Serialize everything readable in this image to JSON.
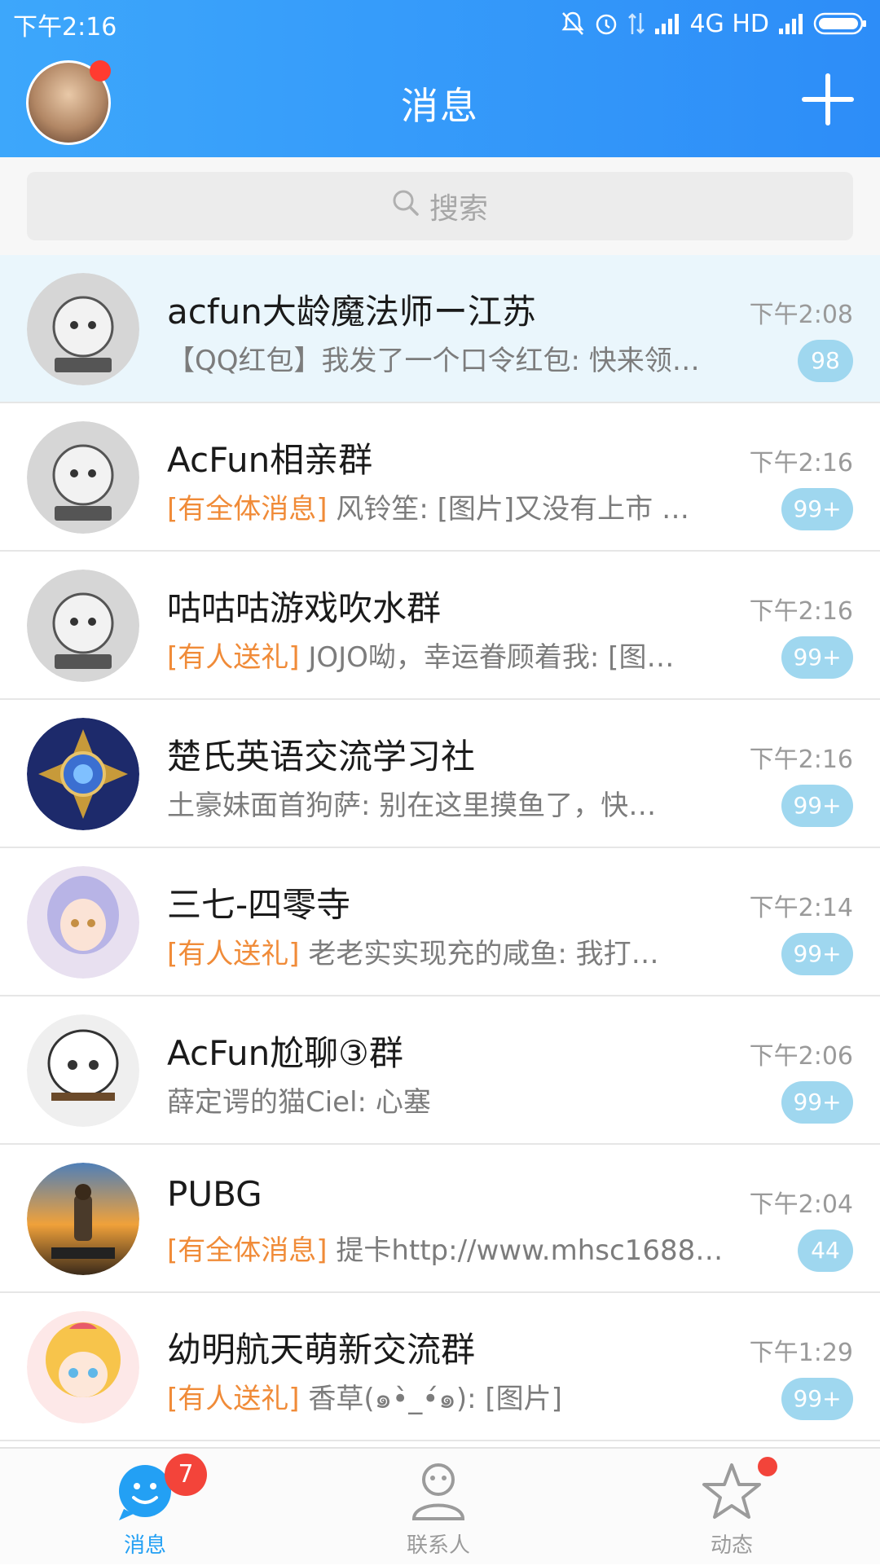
{
  "status_bar": {
    "time": "下午2:16",
    "network": "4G HD"
  },
  "header": {
    "title": "消息"
  },
  "search": {
    "placeholder": "搜索"
  },
  "conversations": [
    {
      "name": "acfun大龄魔法师ー江苏",
      "tag": "",
      "preview": "【QQ红包】我发了一个口令红包: 快来领…",
      "time": "下午2:08",
      "badge": "98",
      "highlight": true
    },
    {
      "name": "AcFun相亲群",
      "tag": "[有全体消息]",
      "preview": " 风铃笙: [图片]又没有上市 …",
      "time": "下午2:16",
      "badge": "99+"
    },
    {
      "name": "咕咕咕游戏吹水群",
      "tag": "[有人送礼]",
      "preview": " JOJO呦，幸运眷顾着我: [图…",
      "time": "下午2:16",
      "badge": "99+"
    },
    {
      "name": "楚氏英语交流学习社",
      "tag": "",
      "preview": "土豪妹面首狗萨: 别在这里摸鱼了，快…",
      "time": "下午2:16",
      "badge": "99+"
    },
    {
      "name": "三七-四零寺",
      "tag": "[有人送礼]",
      "preview": " 老老实实现充的咸鱼: 我打…",
      "time": "下午2:14",
      "badge": "99+"
    },
    {
      "name": "AcFun尬聊③群",
      "tag": "",
      "preview": "薛定谔的猫Ciel: 心塞",
      "time": "下午2:06",
      "badge": "99+"
    },
    {
      "name": "PUBG",
      "tag": "[有全体消息]",
      "preview": " 提卡http://www.mhsc1688…",
      "time": "下午2:04",
      "badge": "44"
    },
    {
      "name": "幼明航天萌新交流群",
      "tag": "[有人送礼]",
      "preview": " 香草(๑•̀_•́๑): [图片]",
      "time": "下午1:29",
      "badge": "99+"
    }
  ],
  "tabs": {
    "messages": {
      "label": "消息",
      "badge": "7"
    },
    "contacts": {
      "label": "联系人"
    },
    "moments": {
      "label": "动态"
    }
  },
  "colors": {
    "header": "#2d8df8",
    "tag": "#f08b38",
    "badge": "#9fd7ef",
    "alert": "#f3443a"
  }
}
